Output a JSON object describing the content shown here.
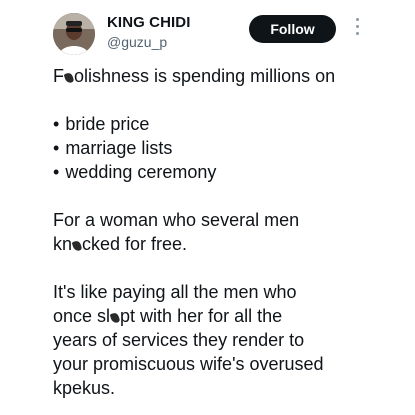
{
  "header": {
    "display_name": "KING CHIDI",
    "handle": "@guzu_p",
    "follow_label": "Follow",
    "more_icon": "more-vertical-icon"
  },
  "tweet": {
    "line1_a": "F",
    "line1_b": "olishness is spending millions on",
    "bullets": [
      "bride price",
      "marriage lists",
      "wedding ceremony"
    ],
    "line2": "For a woman who several men",
    "line3_a": "kn",
    "line3_b": "cked for free.",
    "line4": "It's like paying all the men who",
    "line5_a": "once sl",
    "line5_b": "pt with her for all the",
    "line6": "years of services they render to",
    "line7": "your promiscuous wife's overused",
    "line8": "kpekus."
  }
}
